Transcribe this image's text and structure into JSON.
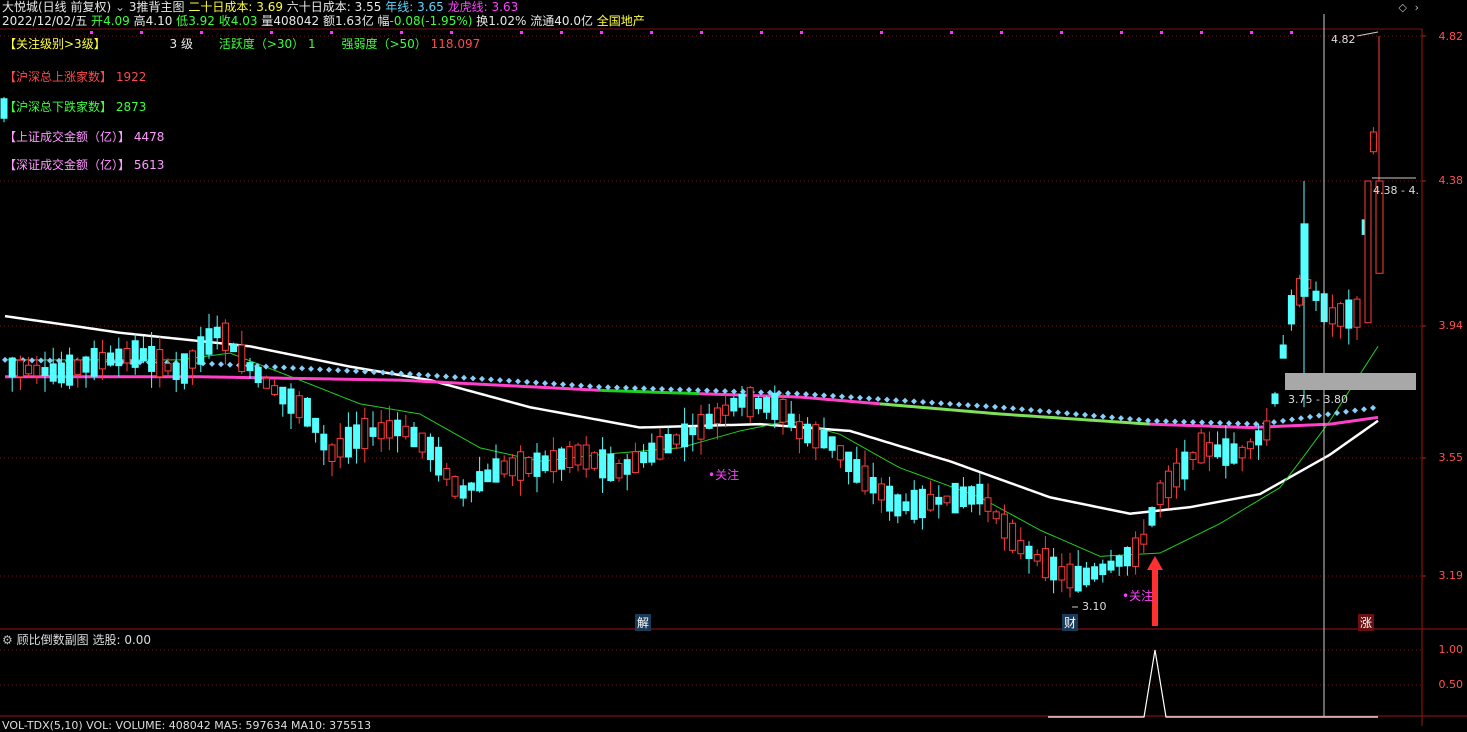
{
  "header": {
    "stock_name": "大悦城(日线 前复权)",
    "dropdown_icon": "chevron-down-icon",
    "indicator_name": "3推背主图",
    "cost20_label": "二十日成本:",
    "cost20_value": "3.69",
    "cost60_label": "六十日成本:",
    "cost60_value": "3.55",
    "yearline_label": "年线:",
    "yearline_value": "3.65",
    "dragon_label": "龙虎线:",
    "dragon_value": "3.63",
    "date": "2022/12/02/五",
    "open_label": "开",
    "open_value": "4.09",
    "high_label": "高",
    "high_value": "4.10",
    "low_label": "低",
    "low_value": "3.92",
    "close_label": "收",
    "close_value": "4.03",
    "vol_label": "量",
    "vol_value": "408042",
    "amount_label": "额",
    "amount_value": "1.63亿",
    "change_label": "幅",
    "change_value": "-0.08(-1.95%)",
    "turnover_label": "换",
    "turnover_value": "1.02%",
    "float_label": "流通",
    "float_value": "40.0亿",
    "sector": "全国地产"
  },
  "indicators": {
    "level_label": "【关注级别>3级】",
    "level_value": "3 级",
    "activity_label": "活跃度（>30）",
    "activity_value": "1",
    "strength_label": "强弱度（>50）",
    "strength_value": "118.097",
    "up_label": "【沪深总上涨家数】",
    "up_value": "1922",
    "down_label": "【沪深总下跌家数】",
    "down_value": "2873",
    "sh_label": "【上证成交金额（亿）】",
    "sh_value": "4478",
    "sz_label": "【深证成交金额（亿）】",
    "sz_value": "5613"
  },
  "price_axis": [
    "4.82",
    "4.38",
    "3.94",
    "3.55",
    "3.19"
  ],
  "sub_axis": [
    "1.00",
    "0.50"
  ],
  "annotations": {
    "high_mark": "4.82",
    "low_mark": "3.10",
    "range1": "4.38 - 4.",
    "range2": "3.75 - 3.80",
    "watch1": "关注",
    "watch2": "关注",
    "event1": "解",
    "event2": "财",
    "event3": "涨"
  },
  "subchart": {
    "title": "顾比倒数副图",
    "select_label": "选股:",
    "select_value": "0.00"
  },
  "volume_bar": {
    "text": "VOL-TDX(5,10)  VOL:  VOLUME: 408042  MA5: 597634  MA10: 375513"
  },
  "colors": {
    "up": "#ff3b3b",
    "down": "#54ffff",
    "ma_white": "#ffffff",
    "ma_green": "#1fcf1f",
    "dragon": "#ff40c8",
    "dots": "#87cefa",
    "grid": "#7a1010"
  },
  "chart_data": {
    "type": "candlestick",
    "series": [
      {
        "name": "二十日成本",
        "values": [
          3.69
        ]
      },
      {
        "name": "六十日成本",
        "values": [
          3.55
        ]
      },
      {
        "name": "年线",
        "values": [
          3.65
        ]
      },
      {
        "name": "龙虎线",
        "values": [
          3.63
        ]
      }
    ],
    "ylim": [
      2.98,
      4.88
    ],
    "yticks": [
      4.82,
      4.38,
      3.94,
      3.55,
      3.19
    ],
    "last_bar": {
      "date": "2022/12/02",
      "open": 4.09,
      "high": 4.1,
      "low": 3.92,
      "close": 4.03
    },
    "period_high": 4.82,
    "period_low": 3.1,
    "sub_yticks": [
      1.0,
      0.5
    ],
    "sub_signal_peak": 1.0
  }
}
